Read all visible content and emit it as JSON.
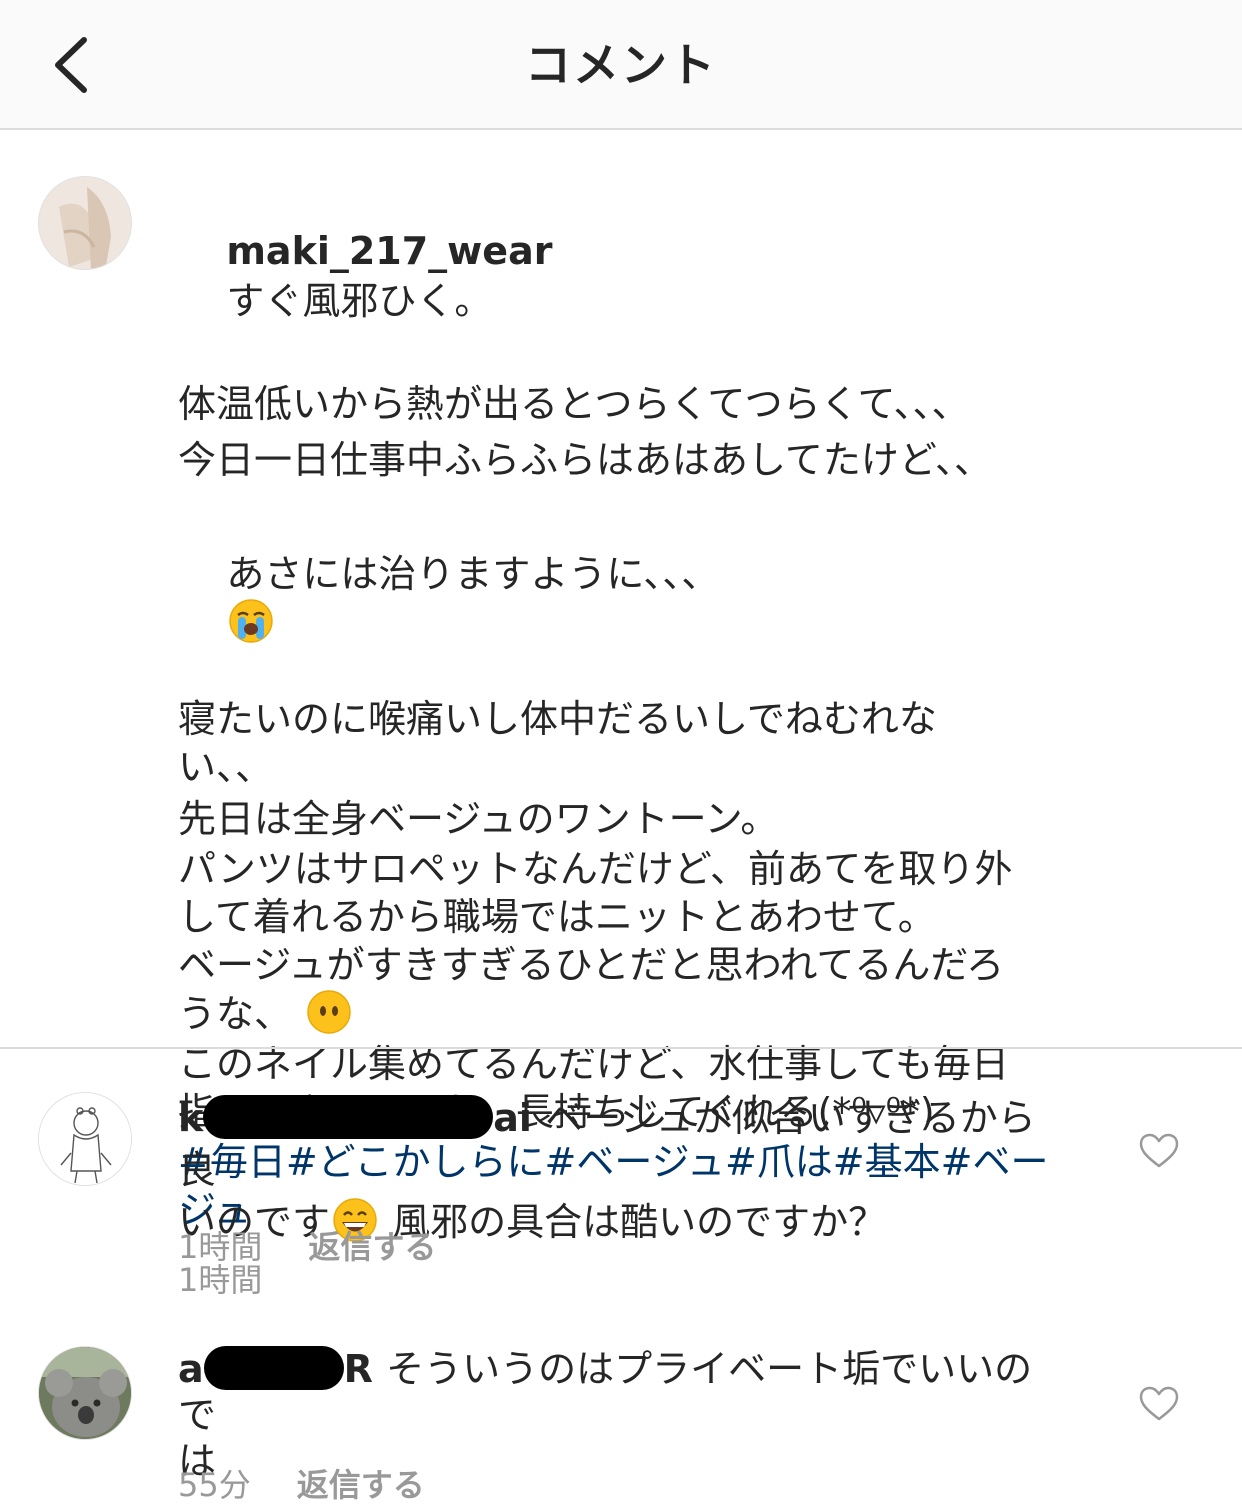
{
  "header": {
    "title": "コメント",
    "back_icon": "chevron-left-icon"
  },
  "caption": {
    "username": "maki_217_wear",
    "line1": "すぐ風邪ひく。",
    "line2": "体温低いから熱が出るとつらくてつらくて、、、",
    "line3": "今日一日仕事中ふらふらはあはあしてたけど、、",
    "line4": "あさには治りますように、、、",
    "emoji1": "crying-face-emoji",
    "line5": "寝たいのに喉痛いし体中だるいしでねむれな\nい、、",
    "line6": "先日は全身ベージュのワントーン。",
    "line7": "パンツはサロペットなんだけど、前あてを取り外\nして着れるから職場ではニットとあわせて。",
    "line8": "ベージュがすきすぎるひとだと思われてるんだろ\nうな、",
    "emoji2": "face-without-mouth-emoji",
    "line9": "このネイル集めてるんだけど、水仕事しても毎日\n指サックしてても、長持ちしてくれる(*⁰▿⁰*)",
    "hashtags": "#毎日#どこかしらに#ベージュ#爪は#基本#ベー\nジュ",
    "timestamp": "1時間"
  },
  "comments": [
    {
      "username_visible_start": "k",
      "username_visible_end": "ai",
      "text_part1": "ベージュが似合いすぎるから良\nいのです",
      "emoji": "grinning-face-emoji",
      "text_part2": "風邪の具合は酷いのですか？",
      "timestamp": "1時間",
      "reply_label": "返信する",
      "like_icon": "heart-outline-icon"
    },
    {
      "username_visible_start": "a",
      "username_visible_end": "R",
      "text": "そういうのはプライベート垢でいいので\nは",
      "timestamp": "55分",
      "reply_label": "返信する",
      "like_icon": "heart-outline-icon"
    }
  ],
  "colors": {
    "hashtag": "#003569",
    "meta": "#999999",
    "text": "#262626",
    "divider": "#dbdbdb",
    "header_bg": "#fafafa"
  }
}
